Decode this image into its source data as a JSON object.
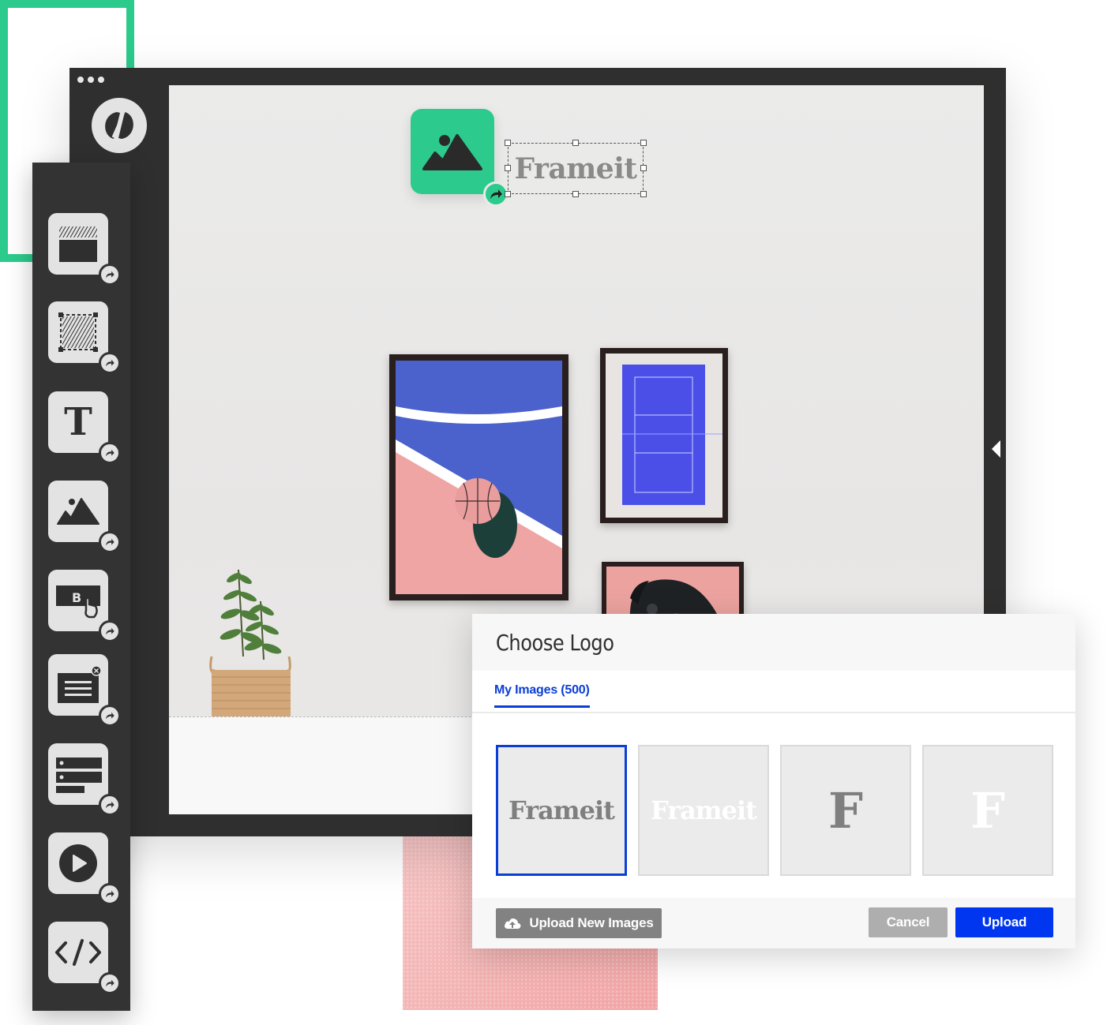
{
  "brand": {
    "accent_green": "#2ccb8d",
    "accent_blue": "#0a3ed6",
    "dark_chrome": "#2f2f2f"
  },
  "editor": {
    "window_controls": [
      "dot",
      "dot",
      "dot"
    ],
    "app_logo_icon": "unbounce-logo-icon",
    "collapse_panel_icon": "triangle-left-icon"
  },
  "canvas": {
    "logo_placeholder_icon": "image-icon",
    "logo_redirect_icon": "curved-arrow-icon",
    "logo_text": "Frameit"
  },
  "sidebar": {
    "tools": [
      {
        "name": "section",
        "icon": "section-icon"
      },
      {
        "name": "box",
        "icon": "box-icon"
      },
      {
        "name": "text",
        "icon": "text-icon",
        "glyph": "T"
      },
      {
        "name": "image",
        "icon": "image-icon"
      },
      {
        "name": "button",
        "icon": "button-icon",
        "glyph": "B"
      },
      {
        "name": "lightbox",
        "icon": "lightbox-icon"
      },
      {
        "name": "form",
        "icon": "form-icon"
      },
      {
        "name": "video",
        "icon": "video-icon"
      },
      {
        "name": "custom-html",
        "icon": "code-icon",
        "glyph": "</>"
      }
    ]
  },
  "dialog": {
    "title": "Choose Logo",
    "tabs": [
      {
        "label": "My Images (500)",
        "active": true
      }
    ],
    "thumbnails": [
      {
        "text": "Frameit",
        "style": "wordmark",
        "color": "#7f7f7f",
        "selected": true
      },
      {
        "text": "Frameit",
        "style": "wordmark",
        "color": "#ffffff",
        "selected": false
      },
      {
        "text": "F",
        "style": "letter",
        "color": "#7f7f7f",
        "selected": false
      },
      {
        "text": "F",
        "style": "letter",
        "color": "#ffffff",
        "selected": false
      }
    ],
    "footer": {
      "upload_new_label": "Upload New Images",
      "upload_new_icon": "cloud-upload-icon",
      "cancel_label": "Cancel",
      "upload_label": "Upload"
    }
  }
}
